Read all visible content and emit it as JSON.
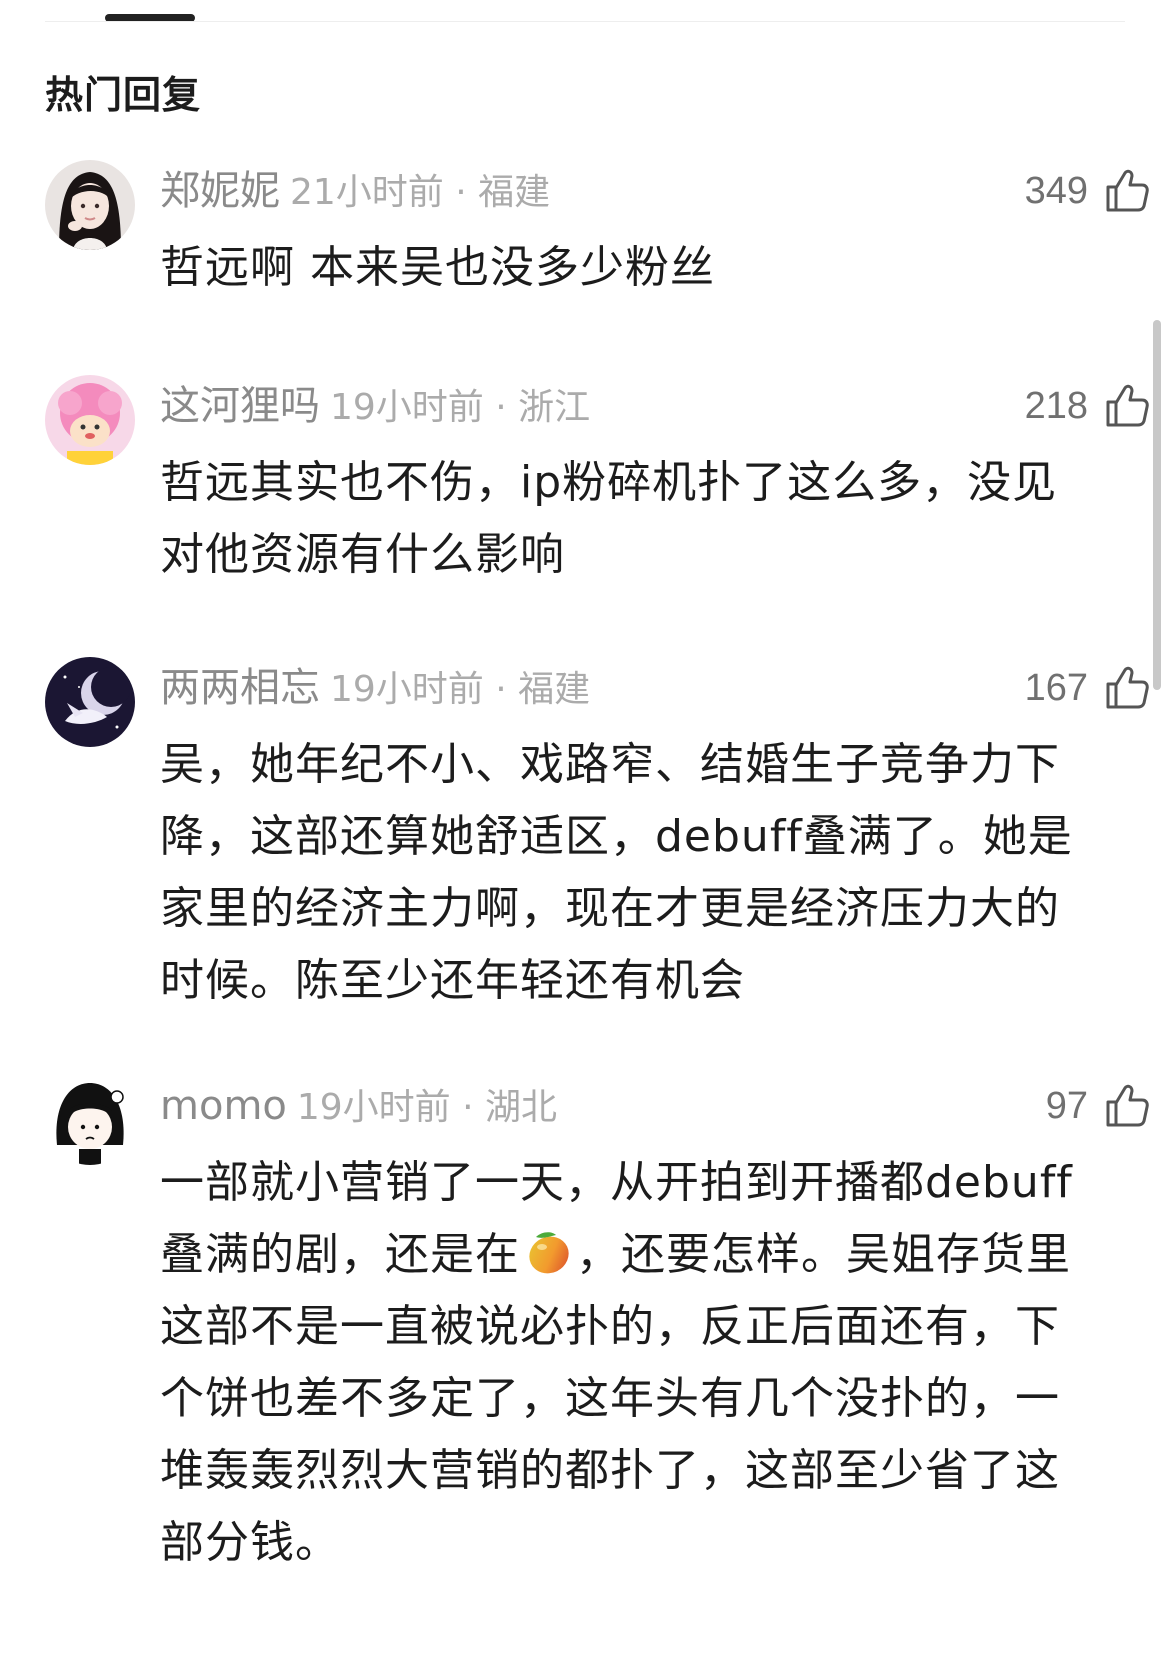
{
  "section_title": "热门回复",
  "colors": {
    "accent_dark": "#222222",
    "meta_gray": "#ababab",
    "name_gray": "#8a8a8a"
  },
  "comments": [
    {
      "user": "郑妮妮",
      "time_location": "21小时前 · 福建",
      "likes": "349",
      "text": "哲远啊 本来吴也没多少粉丝"
    },
    {
      "user": "这河狸吗",
      "time_location": "19小时前 · 浙江",
      "likes": "218",
      "text": "哲远其实也不伤，ip粉碎机扑了这么多，没见对他资源有什么影响"
    },
    {
      "user": "两两相忘",
      "time_location": "19小时前 · 福建",
      "likes": "167",
      "text": "吴，她年纪不小、戏路窄、结婚生子竞争力下降，这部还算她舒适区，debuff叠满了。她是家里的经济主力啊，现在才更是经济压力大的时候。陈至少还年轻还有机会"
    },
    {
      "user": "momo",
      "time_location": "19小时前 · 湖北",
      "likes": "97",
      "text_before_emoji": "一部就小营销了一天，从开拍到开播都debuff叠满的剧，还是在",
      "emoji": "mango-emoji",
      "text_after_emoji": "，还要怎样。吴姐存货里这部不是一直被说必扑的，反正后面还有，下个饼也差不多定了，这年头有几个没扑的，一堆轰轰烈烈大营销的都扑了，这部至少省了这部分钱。"
    }
  ]
}
